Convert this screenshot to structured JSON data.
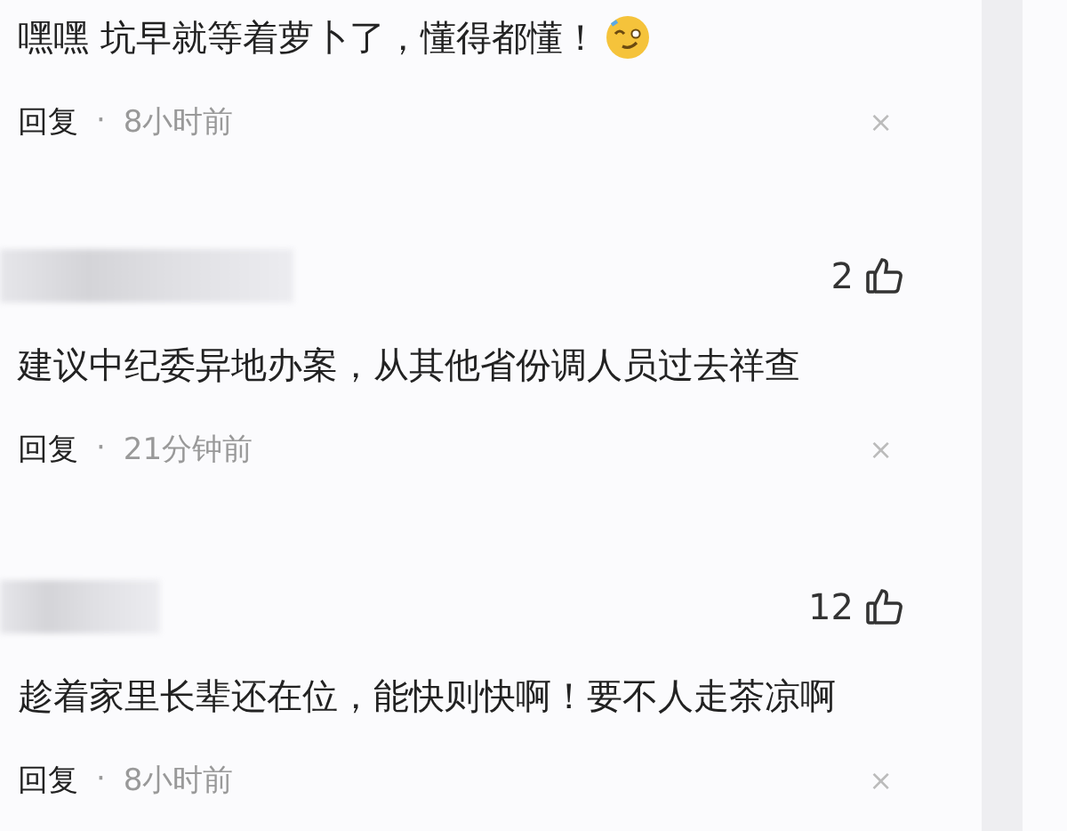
{
  "comments": [
    {
      "author_redacted": false,
      "text": "嘿嘿 坑早就等着萝卜了，懂得都懂！",
      "emoji": true,
      "reply": "回复",
      "separator": "·",
      "time": "8小时前",
      "close": "×"
    },
    {
      "author_redacted": true,
      "likes": "2",
      "text": "建议中纪委异地办案，从其他省份调人员过去祥查",
      "emoji": false,
      "reply": "回复",
      "separator": "·",
      "time": "21分钟前",
      "close": "×"
    },
    {
      "author_redacted": true,
      "likes": "12",
      "text": "趁着家里长辈还在位，能快则快啊！要不人走茶凉啊",
      "emoji": false,
      "reply": "回复",
      "separator": "·",
      "time": "8小时前",
      "close": "×"
    }
  ]
}
